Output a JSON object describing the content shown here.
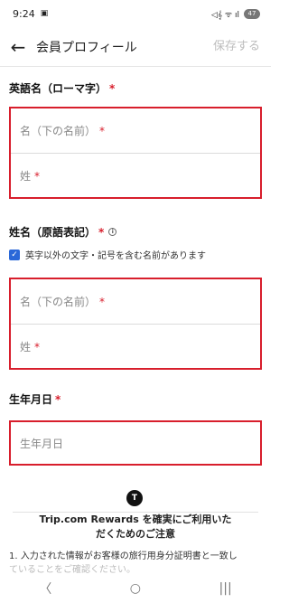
{
  "status_bar": {
    "time": "9:24",
    "right_icons": "◁𝄞 ᯤ ıl",
    "battery": "47"
  },
  "header": {
    "back_icon": "arrow-left-icon",
    "title": "会員プロフィール",
    "save_label": "保存する"
  },
  "sections": {
    "english_name": {
      "title": "英語名（ローマ字）",
      "required_mark": "*",
      "first_name_placeholder": "名（下の名前）",
      "last_name_placeholder": "姓",
      "required_mark_field": "*"
    },
    "native_name": {
      "title": "姓名（原語表記）",
      "required_mark": "*",
      "info_icon": "info-icon",
      "checkbox_label": "英字以外の文字・記号を含む名前があります",
      "checkbox_checked": true,
      "first_name_placeholder": "名（下の名前）",
      "last_name_placeholder": "姓",
      "required_mark_field": "*"
    },
    "birthdate": {
      "title": "生年月日",
      "required_mark": "*",
      "placeholder": "生年月日"
    }
  },
  "rewards": {
    "icon_letter": "T",
    "title_line1": "Trip.com Rewards を確実にご利用いた",
    "title_line2": "だくためのご注意",
    "notice_line1": "1. 入力された情報がお客様の旅行用身分証明書と一致し",
    "notice_line2": "ていることをご確認ください。"
  },
  "nav_bar": {
    "back": "〈",
    "home": "○",
    "recents": "|||"
  },
  "colors": {
    "accent_red": "#d81e2c",
    "checkbox_blue": "#2a68d8",
    "save_disabled": "#bdbdbd"
  }
}
